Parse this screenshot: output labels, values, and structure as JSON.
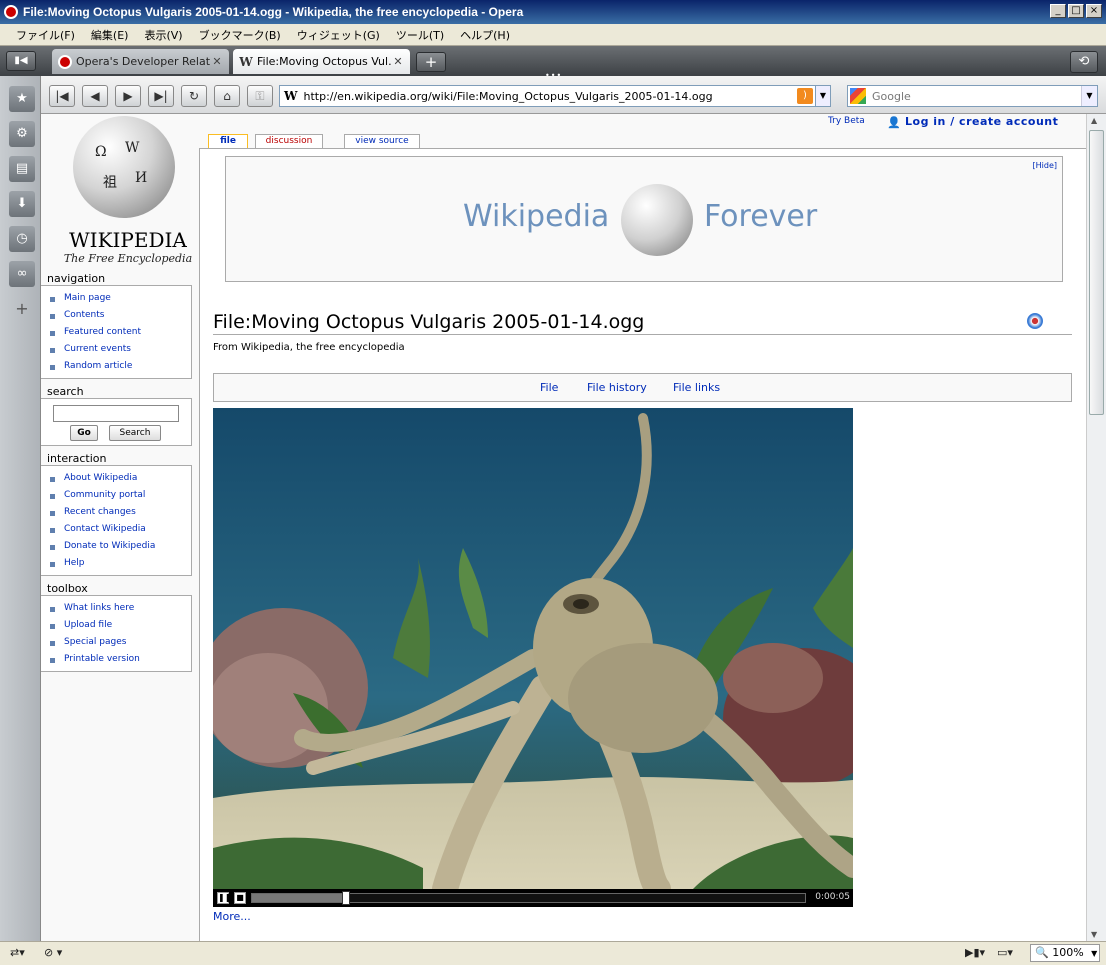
{
  "window": {
    "title": "File:Moving Octopus Vulgaris 2005-01-14.ogg - Wikipedia, the free encyclopedia - Opera"
  },
  "menu": [
    "ファイル(F)",
    "編集(E)",
    "表示(V)",
    "ブックマーク(B)",
    "ウィジェット(G)",
    "ツール(T)",
    "ヘルプ(H)"
  ],
  "tabs": [
    {
      "label": "Opera's Developer Relat...",
      "icon": "opera-icon",
      "active": false
    },
    {
      "label": "File:Moving Octopus Vul...",
      "icon": "wikipedia-icon",
      "active": true
    }
  ],
  "address": {
    "url": "http://en.wikipedia.org/wiki/File:Moving_Octopus_Vulgaris_2005-01-14.ogg",
    "search_placeholder": "Google"
  },
  "logo": {
    "wordmark": "WIKIPEDIA",
    "tagline": "The Free Encyclopedia"
  },
  "top_links": {
    "try_beta": "Try Beta",
    "login": "Log in / create account"
  },
  "content_tabs": {
    "file": "file",
    "discussion": "discussion",
    "view_source": "view source"
  },
  "navigation": {
    "title": "navigation",
    "items": [
      "Main page",
      "Contents",
      "Featured content",
      "Current events",
      "Random article"
    ]
  },
  "search": {
    "title": "search",
    "go": "Go",
    "search": "Search"
  },
  "interaction": {
    "title": "interaction",
    "items": [
      "About Wikipedia",
      "Community portal",
      "Recent changes",
      "Contact Wikipedia",
      "Donate to Wikipedia",
      "Help"
    ]
  },
  "toolbox": {
    "title": "toolbox",
    "items": [
      "What links here",
      "Upload file",
      "Special pages",
      "Printable version"
    ]
  },
  "banner": {
    "hide": "[Hide]",
    "left": "Wikipedia",
    "right": "Forever"
  },
  "article": {
    "title": "File:Moving Octopus Vulgaris 2005-01-14.ogg",
    "subtitle": "From Wikipedia, the free encyclopedia",
    "filetoc": [
      "File",
      "File history",
      "File links"
    ],
    "more": "More..."
  },
  "video": {
    "time": "0:00:05",
    "progress": 0.17
  },
  "status": {
    "zoom": "100%"
  }
}
